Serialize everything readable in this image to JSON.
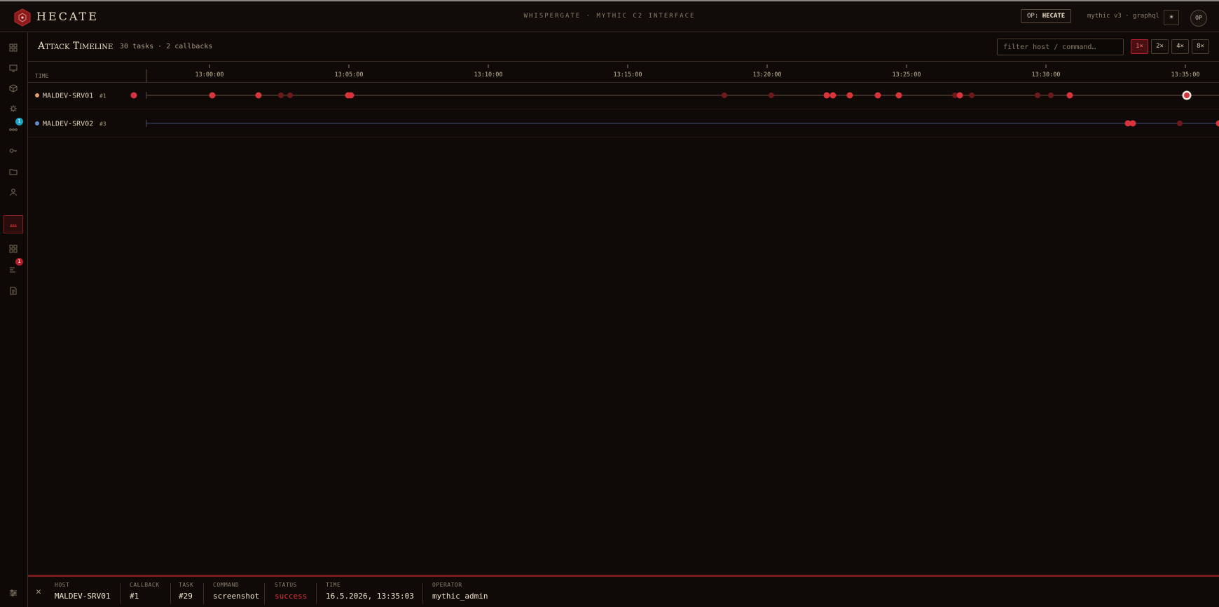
{
  "app": {
    "brand": "HECATE",
    "center_title": "WHISPERGATE · MYTHIC C2 INTERFACE",
    "op_prefix": "OP:",
    "op_name": "HECATE",
    "version": "mythic v3 · graphql",
    "theme_icon": "☀",
    "avatar": "OP"
  },
  "sidebar": {
    "items": [
      {
        "icon": "grid-icon"
      },
      {
        "icon": "monitor-icon"
      },
      {
        "icon": "cube-icon"
      },
      {
        "icon": "bug-icon"
      },
      {
        "icon": "network-icon",
        "badge": "1",
        "badge_color": "cyan"
      },
      {
        "icon": "key-icon"
      },
      {
        "icon": "folder-icon"
      },
      {
        "icon": "user-icon"
      },
      {
        "icon": "timeline-icon",
        "active": true
      },
      {
        "icon": "apps-icon"
      },
      {
        "icon": "list-icon",
        "badge": "1",
        "badge_color": "red"
      },
      {
        "icon": "document-icon"
      }
    ],
    "bottom_icon": "sliders-icon"
  },
  "page": {
    "title": "Attack Timeline",
    "subtitle": "30 tasks · 2 callbacks",
    "filter_placeholder": "filter host / command…",
    "zoom_levels": [
      "1×",
      "2×",
      "4×",
      "8×"
    ],
    "zoom_active": "1×"
  },
  "timeline": {
    "time_label": "TIME",
    "ticks": [
      "13:00:00",
      "13:05:00",
      "13:10:00",
      "13:15:00",
      "13:20:00",
      "13:25:00",
      "13:30:00",
      "13:35:00"
    ],
    "rows": [
      {
        "host": "MALDEV-SRV01",
        "callback": "#1",
        "color": "#e0a070",
        "line_color": "#6a5040"
      },
      {
        "host": "MALDEV-SRV02",
        "callback": "#3",
        "color": "#6a8ad0",
        "line_color": "#3a4a80"
      }
    ]
  },
  "selected_task": {
    "host_label": "HOST",
    "host": "MALDEV-SRV01",
    "callback_label": "CALLBACK",
    "callback": "#1",
    "task_label": "TASK",
    "task": "#29",
    "command_label": "COMMAND",
    "command": "screenshot",
    "status_label": "STATUS",
    "status": "success",
    "time_label": "TIME",
    "time": "16.5.2026, 13:35:03",
    "operator_label": "OPERATOR",
    "operator": "mythic_admin"
  },
  "colors": {
    "accent": "#e0303a",
    "dim_dot": "#6e1a1a",
    "bright_dot": "#d8343c",
    "background": "#0f0a08"
  }
}
